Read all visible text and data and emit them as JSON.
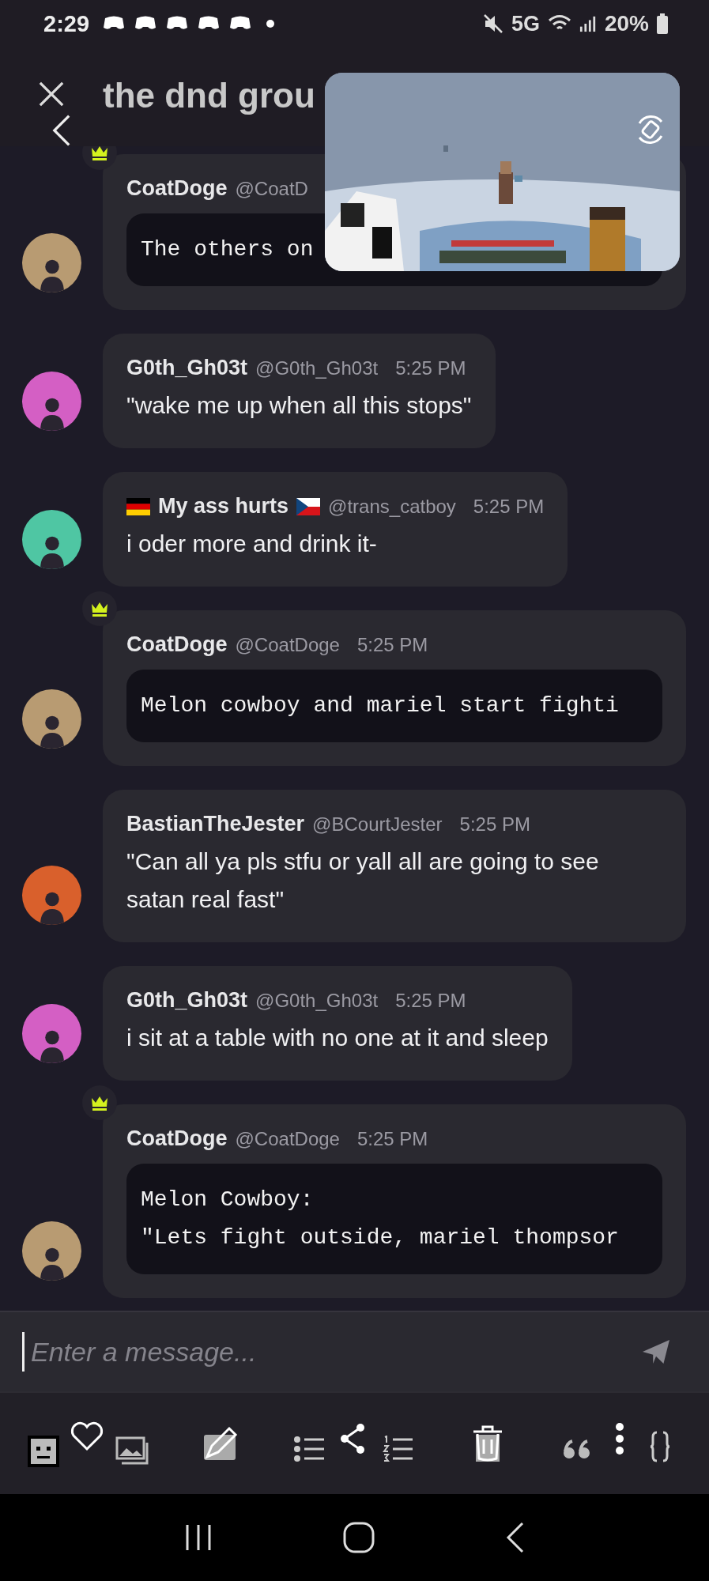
{
  "status_bar": {
    "time": "2:29",
    "network": "5G",
    "battery": "20%"
  },
  "header": {
    "title": "the dnd grou"
  },
  "messages": [
    {
      "author": "CoatDoge",
      "handle": "@CoatD",
      "crown": true,
      "kind": "code",
      "text": "The others on",
      "color": "#b89b72"
    },
    {
      "author": "G0th_Gh03t",
      "handle": "@G0th_Gh03t",
      "time": "5:25 PM",
      "crown": false,
      "kind": "text",
      "text": "\"wake me up when all this stops\"",
      "color": "#d45fc4"
    },
    {
      "author": "My ass hurts",
      "handle": "@trans_catboy",
      "time": "5:25 PM",
      "crown": false,
      "flags": true,
      "kind": "text",
      "text": "i oder more and drink it-",
      "color": "#4fc6a3"
    },
    {
      "author": "CoatDoge",
      "handle": "@CoatDoge",
      "time": "5:25 PM",
      "crown": true,
      "kind": "code",
      "text": "Melon cowboy and mariel start fighti",
      "color": "#b89b72"
    },
    {
      "author": "BastianTheJester",
      "handle": "@BCourtJester",
      "time": "5:25 PM",
      "crown": false,
      "kind": "text",
      "text": "\"Can all ya pls stfu or yall all  are going to see satan real fast\"",
      "color": "#d9602c"
    },
    {
      "author": "G0th_Gh03t",
      "handle": "@G0th_Gh03t",
      "time": "5:25 PM",
      "crown": false,
      "kind": "text",
      "text": "i sit at a table with no one at it and sleep",
      "color": "#d45fc4"
    },
    {
      "author": "CoatDoge",
      "handle": "@CoatDoge",
      "time": "5:25 PM",
      "crown": true,
      "kind": "code",
      "text": "Melon Cowboy:\n\"Lets fight outside, mariel thompsor",
      "color": "#b89b72"
    }
  ],
  "composer": {
    "placeholder": "Enter a message..."
  }
}
